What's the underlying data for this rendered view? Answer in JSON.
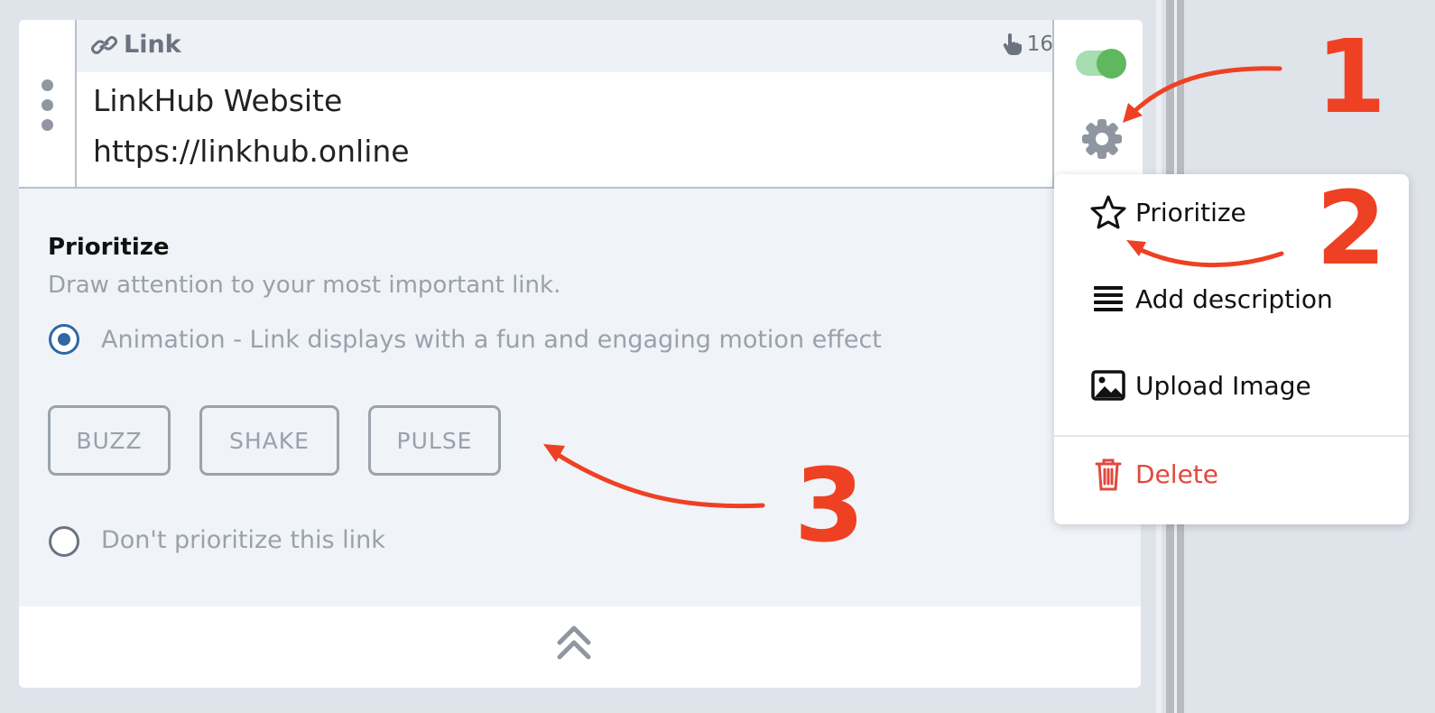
{
  "link": {
    "type_label": "Link",
    "click_count": "16",
    "title": "LinkHub Website",
    "url": "https://linkhub.online",
    "enabled": true
  },
  "prioritize": {
    "heading": "Prioritize",
    "description": "Draw attention to your most important link.",
    "option_animation": "Animation - Link displays with a fun and engaging motion effect",
    "option_none": "Don't prioritize this link",
    "selected": "animation",
    "buttons": [
      "BUZZ",
      "SHAKE",
      "PULSE"
    ]
  },
  "menu": {
    "items": [
      {
        "label": "Prioritize",
        "icon": "star-outline-icon"
      },
      {
        "label": "Add description",
        "icon": "lines-icon"
      },
      {
        "label": "Upload Image",
        "icon": "image-icon"
      },
      {
        "label": "Delete",
        "icon": "trash-icon"
      }
    ]
  },
  "annotations": [
    "1",
    "2",
    "3"
  ],
  "colors": {
    "accent_red": "#ee4123",
    "toggle_green": "#5fb85e",
    "radio_blue": "#2f68a3",
    "delete_red": "#e0493e"
  }
}
